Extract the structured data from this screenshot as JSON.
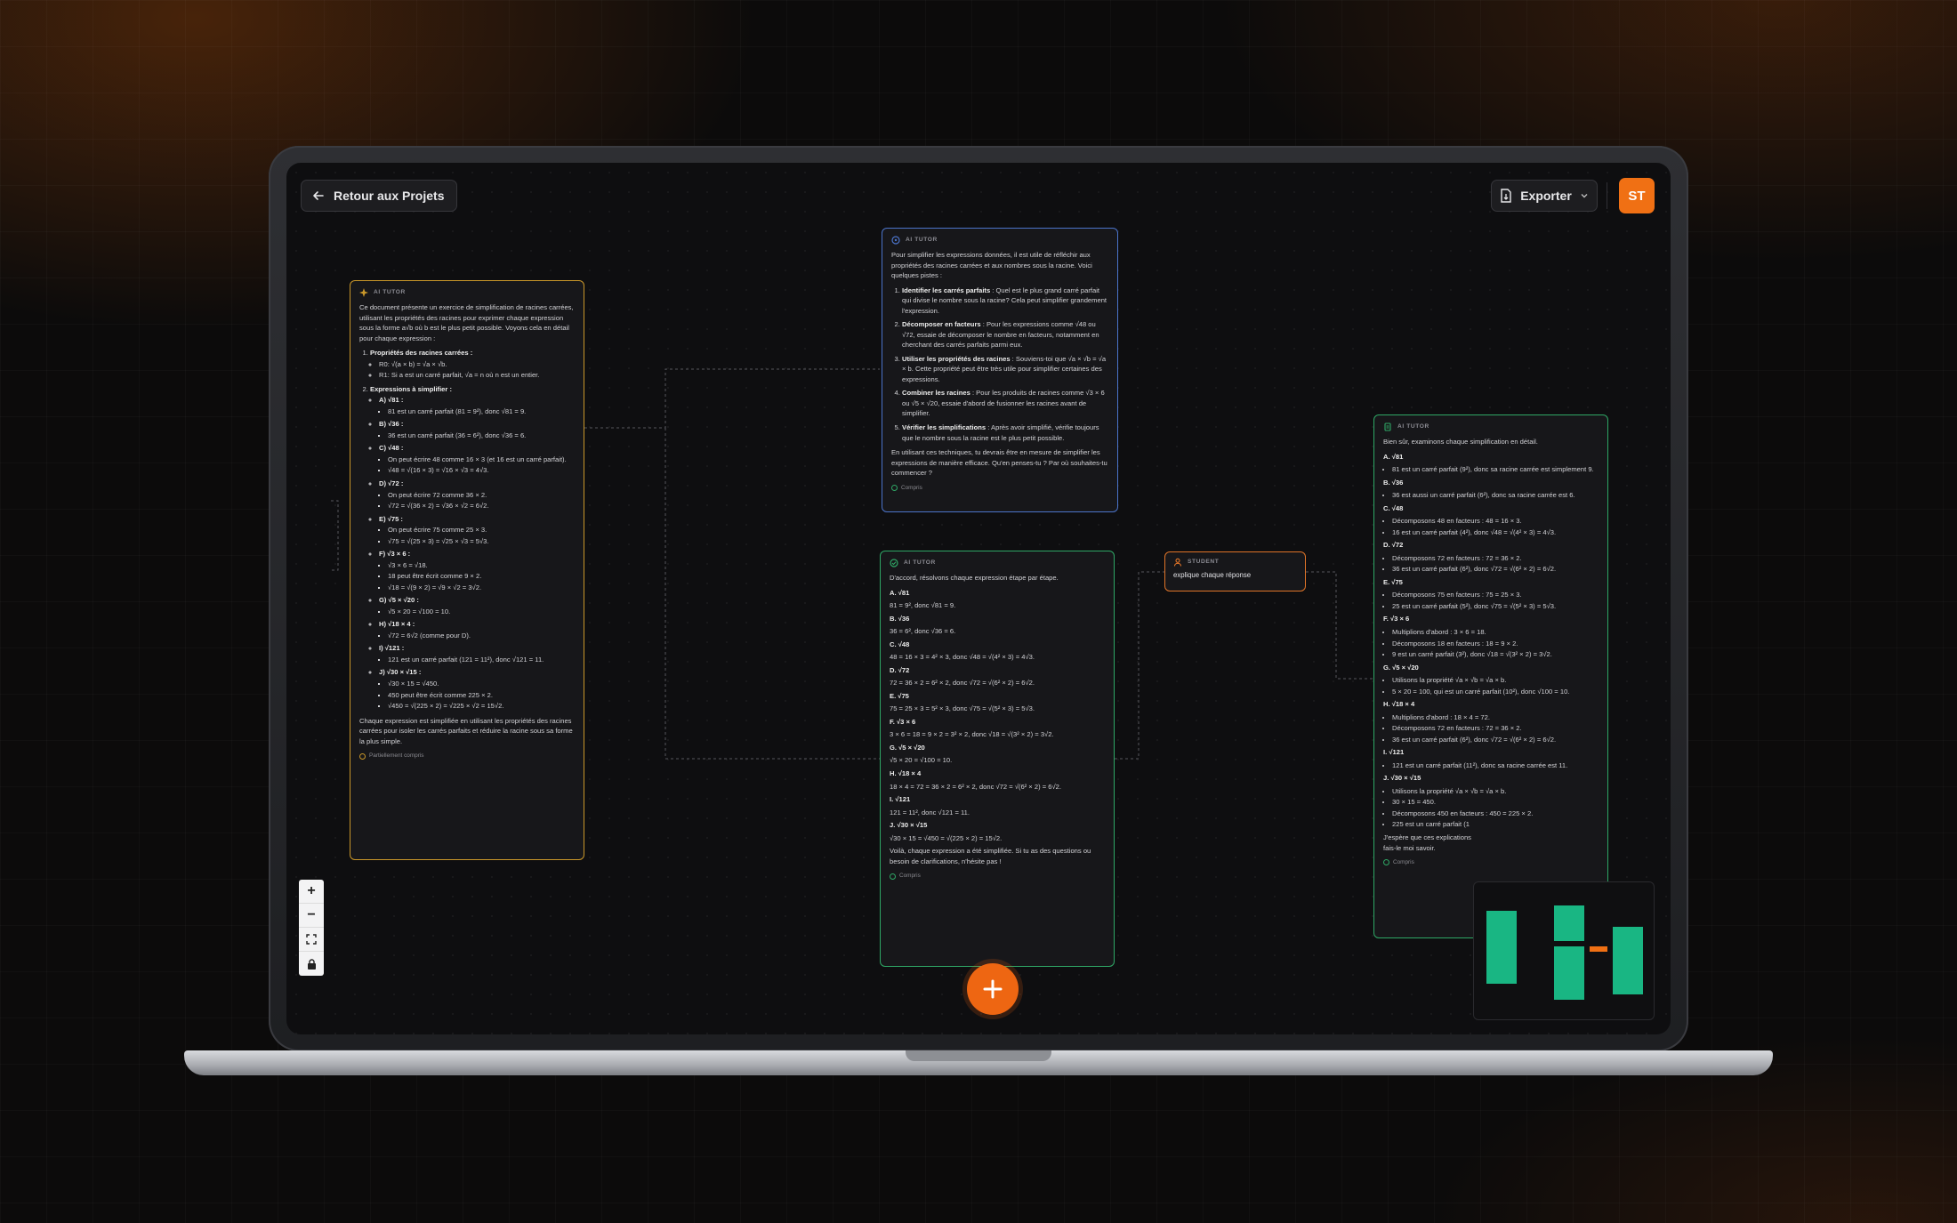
{
  "topbar": {
    "back_label": "Retour aux Projets",
    "export_label": "Exporter",
    "avatar_initials": "ST"
  },
  "colors": {
    "accent": "#f07014",
    "yellow": "#c9972a",
    "blue": "#4b73c9",
    "green": "#2fa866"
  },
  "card1": {
    "label": "AI TUTOR",
    "intro": "Ce document présente un exercice de simplification de racines carrées, utilisant les propriétés des racines pour exprimer chaque expression sous la forme a√b où b est le plus petit possible. Voyons cela en détail pour chaque expression :",
    "s1_title": "Propriétés des racines carrées :",
    "s1_items": [
      "R0: √(a × b) = √a × √b.",
      "R1: Si a est un carré parfait, √a = n où n est un entier."
    ],
    "s2_title": "Expressions à simplifier :",
    "exprs": [
      {
        "label": "A) √81 :",
        "lines": [
          "81 est un carré parfait (81 = 9²), donc √81 = 9."
        ]
      },
      {
        "label": "B) √36 :",
        "lines": [
          "36 est un carré parfait (36 = 6²), donc √36 = 6."
        ]
      },
      {
        "label": "C) √48 :",
        "lines": [
          "On peut écrire 48 comme 16 × 3 (et 16 est un carré parfait).",
          "√48 = √(16 × 3) = √16 × √3 = 4√3."
        ]
      },
      {
        "label": "D) √72 :",
        "lines": [
          "On peut écrire 72 comme 36 × 2.",
          "√72 = √(36 × 2) = √36 × √2 = 6√2."
        ]
      },
      {
        "label": "E) √75 :",
        "lines": [
          "On peut écrire 75 comme 25 × 3.",
          "√75 = √(25 × 3) = √25 × √3 = 5√3."
        ]
      },
      {
        "label": "F) √3 × 6 :",
        "lines": [
          "√3 × 6 = √18.",
          "18 peut être écrit comme 9 × 2.",
          "√18 = √(9 × 2) = √9 × √2 = 3√2."
        ]
      },
      {
        "label": "G) √5 × √20 :",
        "lines": [
          "√5 × 20 = √100 = 10."
        ]
      },
      {
        "label": "H) √18 × 4 :",
        "lines": [
          "√72 = 6√2 (comme pour D)."
        ]
      },
      {
        "label": "I) √121 :",
        "lines": [
          "121 est un carré parfait (121 = 11²), donc √121 = 11."
        ]
      },
      {
        "label": "J) √30 × √15 :",
        "lines": [
          "√30 × 15 = √450.",
          "450 peut être écrit comme 225 × 2.",
          "√450 = √(225 × 2) = √225 × √2 = 15√2."
        ]
      }
    ],
    "conclusion": "Chaque expression est simplifiée en utilisant les propriétés des racines carrées pour isoler les carrés parfaits et réduire la racine sous sa forme la plus simple.",
    "status": "Partiellement compris"
  },
  "card2": {
    "label": "AI TUTOR",
    "intro": "Pour simplifier les expressions données, il est utile de réfléchir aux propriétés des racines carrées et aux nombres sous la racine. Voici quelques pistes :",
    "items": [
      {
        "title": "Identifier les carrés parfaits",
        "text": " : Quel est le plus grand carré parfait qui divise le nombre sous la racine? Cela peut simplifier grandement l'expression."
      },
      {
        "title": "Décomposer en facteurs",
        "text": " : Pour les expressions comme √48 ou √72, essaie de décomposer le nombre en facteurs, notamment en cherchant des carrés parfaits parmi eux."
      },
      {
        "title": "Utiliser les propriétés des racines",
        "text": " : Souviens-toi que √a × √b = √a × b. Cette propriété peut être très utile pour simplifier certaines des expressions."
      },
      {
        "title": "Combiner les racines",
        "text": " : Pour les produits de racines comme √3 × 6 ou √5 × √20, essaie d'abord de fusionner les racines avant de simplifier."
      },
      {
        "title": "Vérifier les simplifications",
        "text": " : Après avoir simplifié, vérifie toujours que le nombre sous la racine est le plus petit possible."
      }
    ],
    "outro": "En utilisant ces techniques, tu devrais être en mesure de simplifier les expressions de manière efficace. Qu'en penses-tu ? Par où souhaites-tu commencer ?",
    "status": "Compris"
  },
  "card3": {
    "label": "AI TUTOR",
    "intro": "D'accord, résolvons chaque expression étape par étape.",
    "steps": [
      {
        "head": "A. √81",
        "body": "81 = 9², donc √81 = 9."
      },
      {
        "head": "B. √36",
        "body": "36 = 6², donc √36 = 6."
      },
      {
        "head": "C. √48",
        "body": "48 = 16 × 3 = 4² × 3, donc √48 = √(4² × 3) = 4√3."
      },
      {
        "head": "D. √72",
        "body": "72 = 36 × 2 = 6² × 2, donc √72 = √(6² × 2) = 6√2."
      },
      {
        "head": "E. √75",
        "body": "75 = 25 × 3 = 5² × 3, donc √75 = √(5² × 3) = 5√3."
      },
      {
        "head": "F. √3 × 6",
        "body": "3 × 6 = 18 = 9 × 2 = 3² × 2, donc √18 = √(3² × 2) = 3√2."
      },
      {
        "head": "G. √5 × √20",
        "body": "√5 × 20 = √100 = 10."
      },
      {
        "head": "H. √18 × 4",
        "body": "18 × 4 = 72 = 36 × 2 = 6² × 2, donc √72 = √(6² × 2) = 6√2."
      },
      {
        "head": "I. √121",
        "body": "121 = 11², donc √121 = 11."
      },
      {
        "head": "J. √30 × √15",
        "body": "√30 × 15 = √450 = √(225 × 2) = 15√2."
      }
    ],
    "outro": "Voilà, chaque expression a été simplifiée. Si tu as des questions ou besoin de clarifications, n'hésite pas !",
    "status": "Compris"
  },
  "card4": {
    "label": "STUDENT",
    "text": "explique chaque réponse"
  },
  "card5": {
    "label": "AI TUTOR",
    "intro": "Bien sûr, examinons chaque simplification en détail.",
    "blocks": [
      {
        "head": "A. √81",
        "lines": [
          "81 est un carré parfait (9²), donc sa racine carrée est simplement 9."
        ]
      },
      {
        "head": "B. √36",
        "lines": [
          "36 est aussi un carré parfait (6²), donc sa racine carrée est 6."
        ]
      },
      {
        "head": "C. √48",
        "lines": [
          "Décomposons 48 en facteurs : 48 = 16 × 3.",
          "16 est un carré parfait (4²), donc √48 = √(4² × 3) = 4√3."
        ]
      },
      {
        "head": "D. √72",
        "lines": [
          "Décomposons 72 en facteurs : 72 = 36 × 2.",
          "36 est un carré parfait (6²), donc √72 = √(6² × 2) = 6√2."
        ]
      },
      {
        "head": "E. √75",
        "lines": [
          "Décomposons 75 en facteurs : 75 = 25 × 3.",
          "25 est un carré parfait (5²), donc √75 = √(5² × 3) = 5√3."
        ]
      },
      {
        "head": "F. √3 × 6",
        "lines": [
          "Multiplions d'abord : 3 × 6 = 18.",
          "Décomposons 18 en facteurs : 18 = 9 × 2.",
          "9 est un carré parfait (3²), donc √18 = √(3² × 2) = 3√2."
        ]
      },
      {
        "head": "G. √5 × √20",
        "lines": [
          "Utilisons la propriété √a × √b = √a × b.",
          "5 × 20 = 100, qui est un carré parfait (10²), donc √100 = 10."
        ]
      },
      {
        "head": "H. √18 × 4",
        "lines": [
          "Multiplions d'abord : 18 × 4 = 72.",
          "Décomposons 72 en facteurs : 72 = 36 × 2.",
          "36 est un carré parfait (6²), donc √72 = √(6² × 2) = 6√2."
        ]
      },
      {
        "head": "I. √121",
        "lines": [
          "121 est un carré parfait (11²), donc sa racine carrée est 11."
        ]
      },
      {
        "head": "J. √30 × √15",
        "lines": [
          "Utilisons la propriété √a × √b = √a × b.",
          "30 × 15 = 450.",
          "Décomposons 450 en facteurs : 450 = 225 × 2.",
          "225 est un carré parfait (1"
        ]
      }
    ],
    "outro": "J'espère que ces explications",
    "outro2": "fais-le moi savoir.",
    "status": "Compris"
  },
  "icons": {
    "back": "arrow-left-icon",
    "export": "file-export-icon",
    "chevron": "chevron-down-icon",
    "plus": "plus-icon",
    "minus": "minus-icon",
    "fit": "fit-view-icon",
    "lock": "lock-icon"
  }
}
